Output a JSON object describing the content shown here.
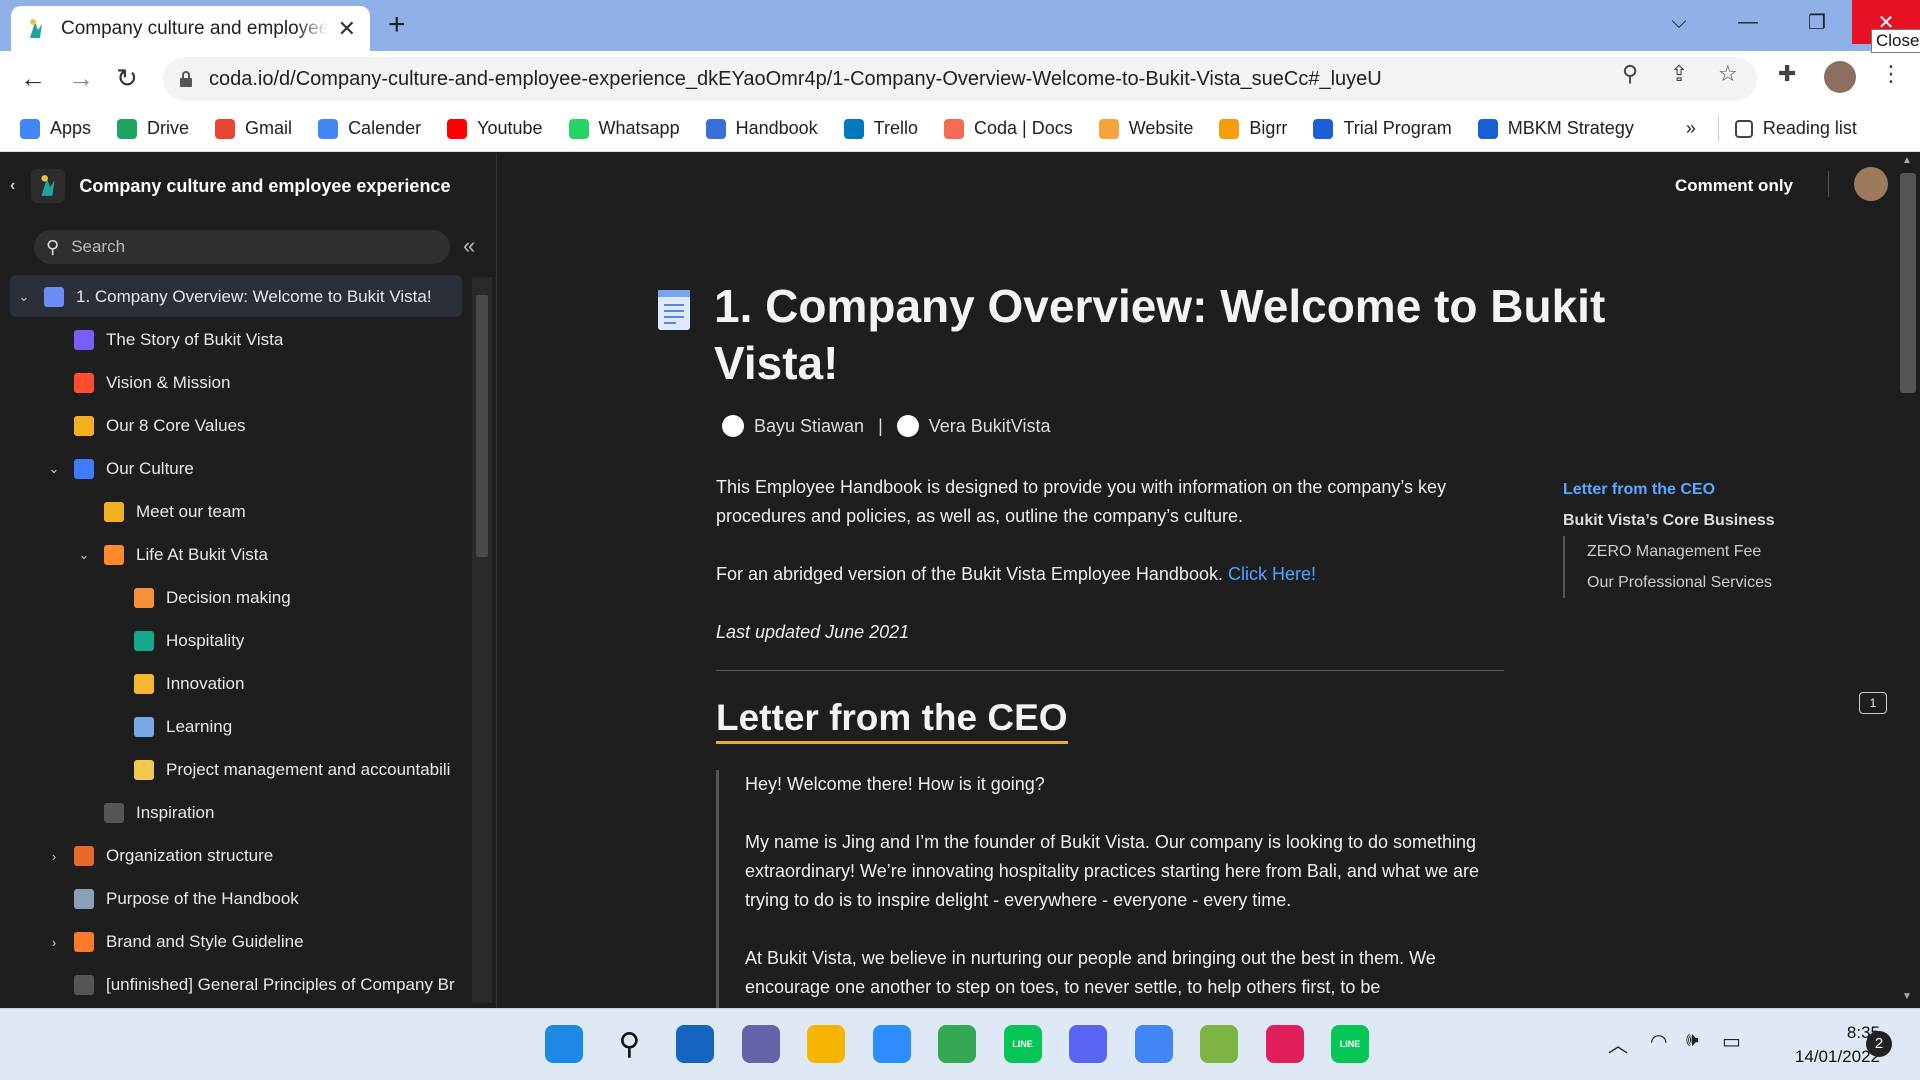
{
  "browser": {
    "tab_title": "Company culture and employee experience",
    "tab_close": "✕",
    "new_tab": "+",
    "close_tooltip": "Close",
    "url": "coda.io/d/Company-culture-and-employee-experience_dkEYaoOmr4p/1-Company-Overview-Welcome-to-Bukit-Vista_sueCc#_luyeU"
  },
  "bookmarks": [
    {
      "label": "Apps",
      "icon": "apps-grid-icon",
      "color": "#4285f4"
    },
    {
      "label": "Drive",
      "icon": "drive-icon",
      "color": "#1fa463"
    },
    {
      "label": "Gmail",
      "icon": "gmail-icon",
      "color": "#ea4335"
    },
    {
      "label": "Calender",
      "icon": "calendar-icon",
      "color": "#4285f4"
    },
    {
      "label": "Youtube",
      "icon": "youtube-icon",
      "color": "#ff0000"
    },
    {
      "label": "Whatsapp",
      "icon": "whatsapp-icon",
      "color": "#25d366"
    },
    {
      "label": "Handbook",
      "icon": "handbook-icon",
      "color": "#3b6fd8"
    },
    {
      "label": "Trello",
      "icon": "trello-icon",
      "color": "#0079bf"
    },
    {
      "label": "Coda | Docs",
      "icon": "coda-icon",
      "color": "#f46a54"
    },
    {
      "label": "Website",
      "icon": "website-icon",
      "color": "#f7a23a"
    },
    {
      "label": "Bigrr",
      "icon": "bigrr-icon",
      "color": "#f59e0b"
    },
    {
      "label": "Trial Program",
      "icon": "trial-program-icon",
      "color": "#1a5fd6"
    },
    {
      "label": "MBKM Strategy",
      "icon": "mbkm-icon",
      "color": "#1a5fd6"
    }
  ],
  "bookmarks_more": "»",
  "reading_list": "Reading list",
  "sidebar": {
    "doc_title": "Company culture and employee experience",
    "search_placeholder": "Search",
    "items": [
      {
        "label": "1. Company Overview: Welcome to Bukit Vista!",
        "level": 0,
        "chevron": "⌄",
        "color": "#6b8df5"
      },
      {
        "label": "The Story of Bukit Vista",
        "level": 1,
        "chevron": "",
        "color": "#7b5cff"
      },
      {
        "label": "Vision & Mission",
        "level": 1,
        "chevron": "",
        "color": "#ff4d2e"
      },
      {
        "label": "Our 8 Core Values",
        "level": 1,
        "chevron": "",
        "color": "#f2b01e"
      },
      {
        "label": "Our Culture",
        "level": 1,
        "chevron": "⌄",
        "color": "#3f7bff"
      },
      {
        "label": "Meet our team",
        "level": 2,
        "chevron": "",
        "color": "#f2b01e"
      },
      {
        "label": "Life At Bukit Vista",
        "level": 2,
        "chevron": "⌄",
        "color": "#ff8a2b"
      },
      {
        "label": "Decision making",
        "level": 3,
        "chevron": "",
        "color": "#f7903a"
      },
      {
        "label": "Hospitality",
        "level": 3,
        "chevron": "",
        "color": "#15a88a"
      },
      {
        "label": "Innovation",
        "level": 3,
        "chevron": "",
        "color": "#f7b731"
      },
      {
        "label": "Learning",
        "level": 3,
        "chevron": "",
        "color": "#7aa7e8"
      },
      {
        "label": "Project management and accountabili",
        "level": 3,
        "chevron": "",
        "color": "#f2c94c"
      },
      {
        "label": "Inspiration",
        "level": 2,
        "chevron": "",
        "color": "#555555"
      },
      {
        "label": "Organization structure",
        "level": 1,
        "chevron": "›",
        "color": "#e86a2a"
      },
      {
        "label": "Purpose of the Handbook",
        "level": 1,
        "chevron": "",
        "color": "#8aa0b8"
      },
      {
        "label": "Brand and Style Guideline",
        "level": 1,
        "chevron": "›",
        "color": "#ff7a2a"
      },
      {
        "label": "[unfinished] General Principles of Company Br",
        "level": 1,
        "chevron": "",
        "color": "#555555"
      }
    ]
  },
  "main": {
    "comment_only": "Comment only",
    "title": "1. Company Overview: Welcome to Bukit Vista!",
    "author1": "Bayu Stiawan",
    "author_sep": "|",
    "author2": "Vera BukitVista",
    "intro1": "This Employee Handbook is designed to provide you with information on the company’s key procedures and policies, as well as, outline the company’s culture.",
    "intro2_text": "For an abridged version of the Bukit Vista Employee Handbook. ",
    "intro2_link": "Click Here!",
    "updated": "Last updated June 2021",
    "h2": "Letter from the CEO",
    "quote_p1": "Hey! Welcome there! How is it going?",
    "quote_p2": "My name is Jing and I’m the founder of Bukit Vista. Our company is looking to do something extraordinary! We’re innovating hospitality practices starting here from Bali, and what we are trying to do is to inspire delight - everywhere - everyone - every time.",
    "quote_p3": "At Bukit Vista, we believe in nurturing our people and bringing out the best in them. We encourage one another to step on toes, to never settle, to help others first, to be",
    "toc": {
      "l1": "Letter from the CEO",
      "l2": "Bukit Vista’s Core Business",
      "sub1": "ZERO Management Fee",
      "sub2": "Our Professional Services"
    },
    "comment_count": "1"
  },
  "taskbar": {
    "time": "8:35",
    "date": "14/01/2022",
    "notifications": "2",
    "apps": [
      {
        "name": "windows-start-icon",
        "color": "#1e88e5",
        "label": ""
      },
      {
        "name": "search-icon",
        "color": "transparent",
        "label": ""
      },
      {
        "name": "task-view-icon",
        "color": "#1565c0",
        "label": ""
      },
      {
        "name": "teams-chat-icon",
        "color": "#6264a7",
        "label": ""
      },
      {
        "name": "file-explorer-icon",
        "color": "#f4b400",
        "label": ""
      },
      {
        "name": "zoom-icon",
        "color": "#2d8cff",
        "label": ""
      },
      {
        "name": "chrome-icon",
        "color": "#34a853",
        "label": ""
      },
      {
        "name": "line-icon",
        "color": "#06c755",
        "label": "LINE"
      },
      {
        "name": "discord-icon",
        "color": "#5865f2",
        "label": ""
      },
      {
        "name": "chrome-profile-1-icon",
        "color": "#4285f4",
        "label": ""
      },
      {
        "name": "chrome-profile-2-icon",
        "color": "#7cb342",
        "label": ""
      },
      {
        "name": "slack-icon",
        "color": "#e01e5a",
        "label": ""
      },
      {
        "name": "line-icon-2",
        "color": "#06c755",
        "label": "LINE"
      }
    ]
  }
}
